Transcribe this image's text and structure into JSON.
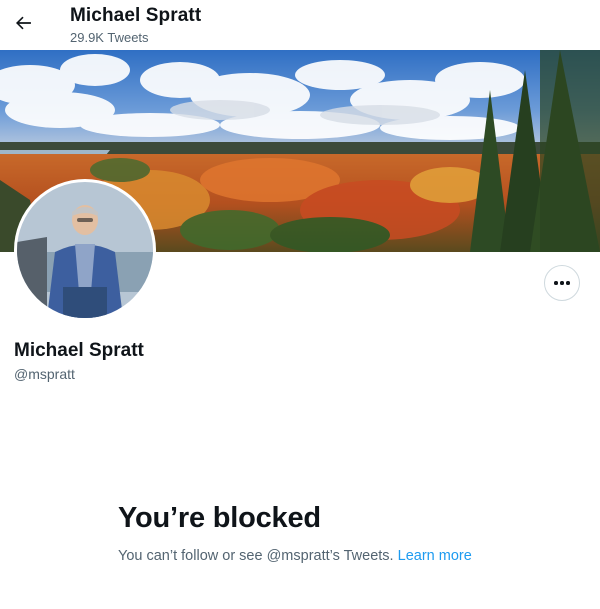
{
  "header": {
    "back_icon": "arrow-left-icon",
    "name": "Michael Spratt",
    "tweet_count": "29.9K Tweets"
  },
  "banner": {
    "description_icon": "autumn-forest-landscape-photo"
  },
  "profile": {
    "avatar_icon": "profile-photo",
    "more_icon": "more-horizontal-icon",
    "name": "Michael Spratt",
    "handle": "@mspratt"
  },
  "blocked": {
    "title": "You’re blocked",
    "message": "You can’t follow or see @mspratt’s Tweets.",
    "link_label": "Learn more",
    "link_color": "#1d9bf0"
  }
}
